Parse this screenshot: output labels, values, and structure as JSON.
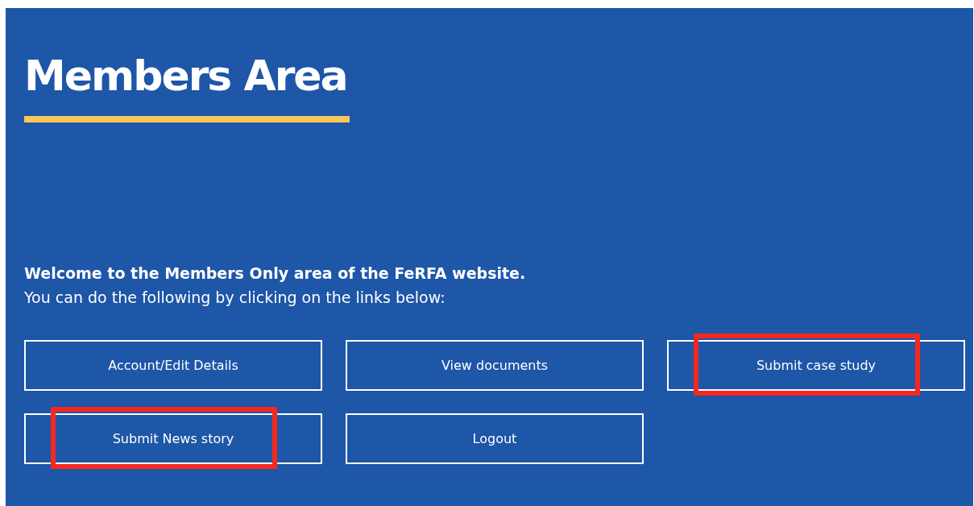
{
  "title": "Members Area",
  "intro": {
    "heading": "Welcome to the Members Only area of the FeRFA website.",
    "text": "You can do the following by clicking on the links below:"
  },
  "links": [
    {
      "label": "Account/Edit Details",
      "highlighted": false
    },
    {
      "label": "View documents",
      "highlighted": false
    },
    {
      "label": "Submit case study",
      "highlighted": true
    },
    {
      "label": "Submit News story",
      "highlighted": true
    },
    {
      "label": "Logout",
      "highlighted": false
    }
  ]
}
